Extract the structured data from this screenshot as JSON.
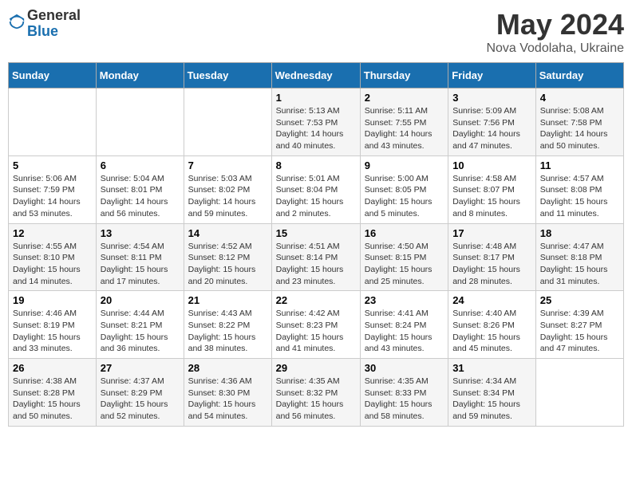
{
  "header": {
    "logo_general": "General",
    "logo_blue": "Blue",
    "month_title": "May 2024",
    "location": "Nova Vodolaha, Ukraine"
  },
  "days_of_week": [
    "Sunday",
    "Monday",
    "Tuesday",
    "Wednesday",
    "Thursday",
    "Friday",
    "Saturday"
  ],
  "weeks": [
    [
      {
        "num": "",
        "info": ""
      },
      {
        "num": "",
        "info": ""
      },
      {
        "num": "",
        "info": ""
      },
      {
        "num": "1",
        "info": "Sunrise: 5:13 AM\nSunset: 7:53 PM\nDaylight: 14 hours\nand 40 minutes."
      },
      {
        "num": "2",
        "info": "Sunrise: 5:11 AM\nSunset: 7:55 PM\nDaylight: 14 hours\nand 43 minutes."
      },
      {
        "num": "3",
        "info": "Sunrise: 5:09 AM\nSunset: 7:56 PM\nDaylight: 14 hours\nand 47 minutes."
      },
      {
        "num": "4",
        "info": "Sunrise: 5:08 AM\nSunset: 7:58 PM\nDaylight: 14 hours\nand 50 minutes."
      }
    ],
    [
      {
        "num": "5",
        "info": "Sunrise: 5:06 AM\nSunset: 7:59 PM\nDaylight: 14 hours\nand 53 minutes."
      },
      {
        "num": "6",
        "info": "Sunrise: 5:04 AM\nSunset: 8:01 PM\nDaylight: 14 hours\nand 56 minutes."
      },
      {
        "num": "7",
        "info": "Sunrise: 5:03 AM\nSunset: 8:02 PM\nDaylight: 14 hours\nand 59 minutes."
      },
      {
        "num": "8",
        "info": "Sunrise: 5:01 AM\nSunset: 8:04 PM\nDaylight: 15 hours\nand 2 minutes."
      },
      {
        "num": "9",
        "info": "Sunrise: 5:00 AM\nSunset: 8:05 PM\nDaylight: 15 hours\nand 5 minutes."
      },
      {
        "num": "10",
        "info": "Sunrise: 4:58 AM\nSunset: 8:07 PM\nDaylight: 15 hours\nand 8 minutes."
      },
      {
        "num": "11",
        "info": "Sunrise: 4:57 AM\nSunset: 8:08 PM\nDaylight: 15 hours\nand 11 minutes."
      }
    ],
    [
      {
        "num": "12",
        "info": "Sunrise: 4:55 AM\nSunset: 8:10 PM\nDaylight: 15 hours\nand 14 minutes."
      },
      {
        "num": "13",
        "info": "Sunrise: 4:54 AM\nSunset: 8:11 PM\nDaylight: 15 hours\nand 17 minutes."
      },
      {
        "num": "14",
        "info": "Sunrise: 4:52 AM\nSunset: 8:12 PM\nDaylight: 15 hours\nand 20 minutes."
      },
      {
        "num": "15",
        "info": "Sunrise: 4:51 AM\nSunset: 8:14 PM\nDaylight: 15 hours\nand 23 minutes."
      },
      {
        "num": "16",
        "info": "Sunrise: 4:50 AM\nSunset: 8:15 PM\nDaylight: 15 hours\nand 25 minutes."
      },
      {
        "num": "17",
        "info": "Sunrise: 4:48 AM\nSunset: 8:17 PM\nDaylight: 15 hours\nand 28 minutes."
      },
      {
        "num": "18",
        "info": "Sunrise: 4:47 AM\nSunset: 8:18 PM\nDaylight: 15 hours\nand 31 minutes."
      }
    ],
    [
      {
        "num": "19",
        "info": "Sunrise: 4:46 AM\nSunset: 8:19 PM\nDaylight: 15 hours\nand 33 minutes."
      },
      {
        "num": "20",
        "info": "Sunrise: 4:44 AM\nSunset: 8:21 PM\nDaylight: 15 hours\nand 36 minutes."
      },
      {
        "num": "21",
        "info": "Sunrise: 4:43 AM\nSunset: 8:22 PM\nDaylight: 15 hours\nand 38 minutes."
      },
      {
        "num": "22",
        "info": "Sunrise: 4:42 AM\nSunset: 8:23 PM\nDaylight: 15 hours\nand 41 minutes."
      },
      {
        "num": "23",
        "info": "Sunrise: 4:41 AM\nSunset: 8:24 PM\nDaylight: 15 hours\nand 43 minutes."
      },
      {
        "num": "24",
        "info": "Sunrise: 4:40 AM\nSunset: 8:26 PM\nDaylight: 15 hours\nand 45 minutes."
      },
      {
        "num": "25",
        "info": "Sunrise: 4:39 AM\nSunset: 8:27 PM\nDaylight: 15 hours\nand 47 minutes."
      }
    ],
    [
      {
        "num": "26",
        "info": "Sunrise: 4:38 AM\nSunset: 8:28 PM\nDaylight: 15 hours\nand 50 minutes."
      },
      {
        "num": "27",
        "info": "Sunrise: 4:37 AM\nSunset: 8:29 PM\nDaylight: 15 hours\nand 52 minutes."
      },
      {
        "num": "28",
        "info": "Sunrise: 4:36 AM\nSunset: 8:30 PM\nDaylight: 15 hours\nand 54 minutes."
      },
      {
        "num": "29",
        "info": "Sunrise: 4:35 AM\nSunset: 8:32 PM\nDaylight: 15 hours\nand 56 minutes."
      },
      {
        "num": "30",
        "info": "Sunrise: 4:35 AM\nSunset: 8:33 PM\nDaylight: 15 hours\nand 58 minutes."
      },
      {
        "num": "31",
        "info": "Sunrise: 4:34 AM\nSunset: 8:34 PM\nDaylight: 15 hours\nand 59 minutes."
      },
      {
        "num": "",
        "info": ""
      }
    ]
  ]
}
